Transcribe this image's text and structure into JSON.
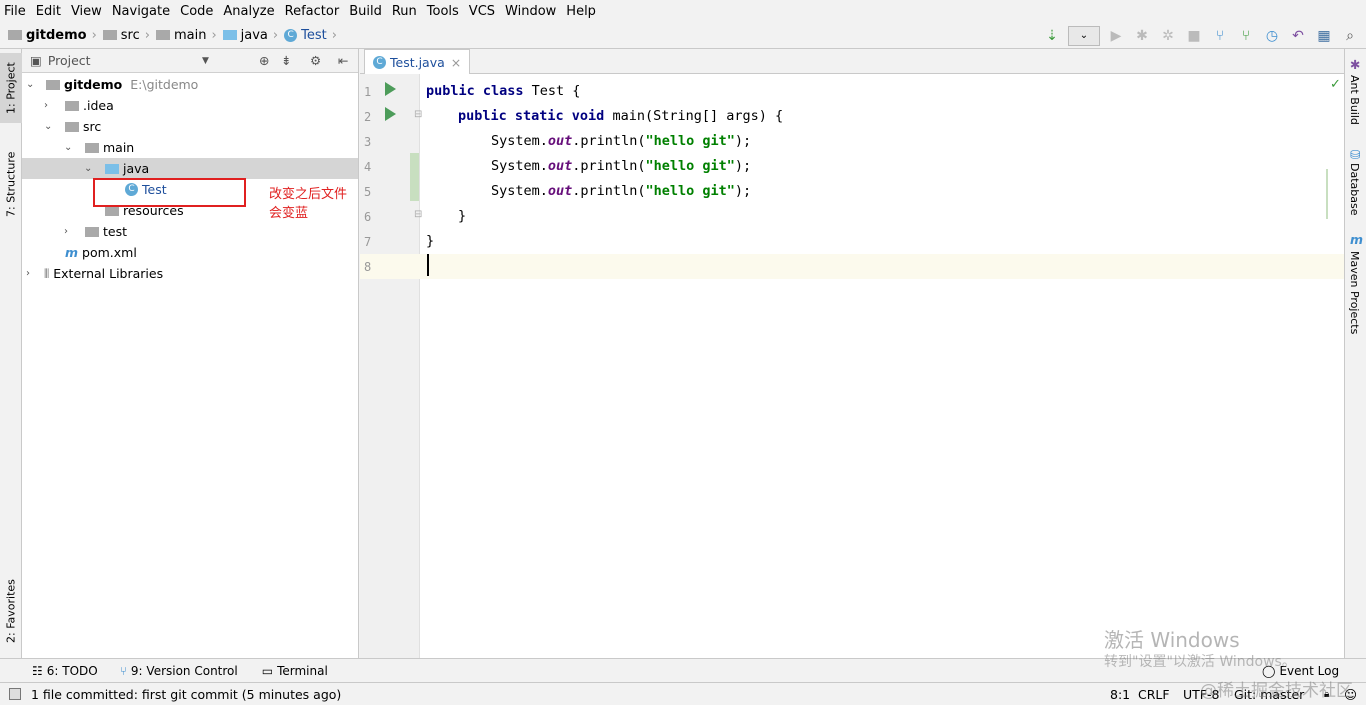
{
  "menu": [
    "File",
    "Edit",
    "View",
    "Navigate",
    "Code",
    "Analyze",
    "Refactor",
    "Build",
    "Run",
    "Tools",
    "VCS",
    "Window",
    "Help"
  ],
  "breadcrumb": [
    "gitdemo",
    "src",
    "main",
    "java",
    "Test"
  ],
  "left_tabs": {
    "project": "1: Project",
    "structure": "7: Structure",
    "favorites": "2: Favorites"
  },
  "project_panel": {
    "title": "Project",
    "root": "gitdemo",
    "root_path": "E:\\gitdemo",
    "items": {
      "idea": ".idea",
      "src": "src",
      "main": "main",
      "java": "java",
      "test_class": "Test",
      "resources": "resources",
      "test": "test",
      "pom": "pom.xml",
      "ext": "External Libraries"
    }
  },
  "annotation": "改变之后文件会变蓝",
  "editor": {
    "tab": "Test.java",
    "line_numbers": [
      "1",
      "2",
      "3",
      "4",
      "5",
      "6",
      "7",
      "8"
    ],
    "lines": {
      "l1a": "public class ",
      "l1b": "Test {",
      "l2a": "public static void ",
      "l2b": "main(String[] args) {",
      "sys": "System.",
      "out": "out",
      ".println(": ".println(",
      "str": "\"hello git\"",
      "end": ");",
      "l6": "}",
      "l7": "}"
    }
  },
  "right_tabs": [
    "Ant Build",
    "Database",
    "Maven Projects"
  ],
  "bottom_tabs": [
    "6: TODO",
    "9: Version Control",
    "Terminal"
  ],
  "event_log": "Event Log",
  "status": {
    "message": "1 file committed: first git commit (5 minutes ago)",
    "position": "8:1",
    "line_sep": "CRLF",
    "encoding": "UTF-8",
    "branch": "Git: master"
  },
  "watermark": {
    "activate": "激活 Windows",
    "activate_sub": "转到\"设置\"以激活 Windows。",
    "site": "@稀土掘金技术社区"
  },
  "colors": {
    "keyword": "#000080",
    "string": "#008000",
    "field": "#660e7a",
    "annotation": "#e02020"
  }
}
